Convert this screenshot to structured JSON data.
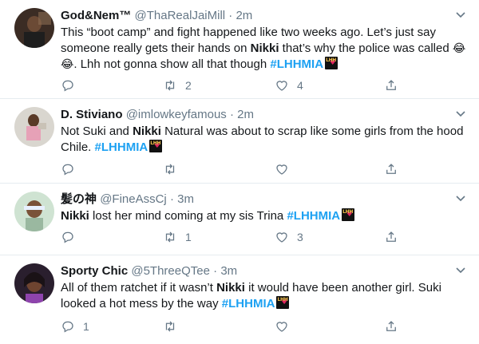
{
  "tweets": [
    {
      "name": "God&Nem™",
      "handle": "@ThaRealJaiMill",
      "dot": "·",
      "time": "2m",
      "text_parts": [
        "This “boot camp” and fight happened like two weeks ago. Let’s just say someone really gets their hands on ",
        "Nikki",
        " that’s why the police was called ",
        "😂😂",
        ". Lhh not gonna show all that though "
      ],
      "hashtag": "#LHHMIA",
      "retweets": "2",
      "likes": "4"
    },
    {
      "name": "D. Stiviano",
      "handle": "@imlowkeyfamous",
      "dot": "·",
      "time": "2m",
      "text_parts": [
        "Not Suki and ",
        "Nikki",
        " Natural was about to scrap like some girls from the hood Chile. "
      ],
      "hashtag": "#LHHMIA",
      "retweets": "",
      "likes": ""
    },
    {
      "name": "髪の神",
      "handle": "@FineAssCj",
      "dot": "·",
      "time": "3m",
      "text_parts": [
        "Nikki",
        " lost her mind coming at my sis Trina "
      ],
      "hashtag": "#LHHMIA",
      "retweets": "1",
      "likes": "3"
    },
    {
      "name": "Sporty Chic",
      "handle": "@5ThreeQTee",
      "dot": "·",
      "time": "3m",
      "text_parts": [
        "All of them ratchet if it wasn’t ",
        "Nikki",
        " it would have been another girl. Suki looked a hot mess by the way "
      ],
      "hashtag": "#LHHMIA",
      "replies": "1",
      "retweets": "",
      "likes": ""
    }
  ],
  "colors": {
    "accent": "#1da1f2",
    "secondary_text": "#657786",
    "divider": "#e6ecf0"
  }
}
